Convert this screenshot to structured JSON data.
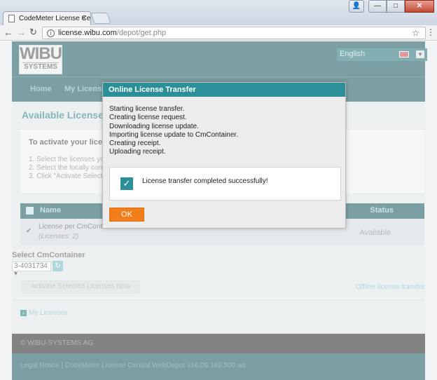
{
  "browser": {
    "tab_title": "CodeMeter License Centr",
    "url_host": "license.wibu.com",
    "url_path": "/depot/get.php"
  },
  "header": {
    "logo_top": "WIBU",
    "logo_bottom": "SYSTEMS",
    "language": "English"
  },
  "nav": {
    "items": [
      "Home",
      "My License"
    ]
  },
  "main": {
    "title": "Available Licenses",
    "activate_title": "To activate your licens",
    "steps": [
      "1. Select the licenses yo",
      "2. Select the locally con",
      "3. Click \"Activate Select"
    ],
    "table": {
      "col_name": "Name",
      "col_status": "Status",
      "row_name": "License per CmConta",
      "row_count": "(Licenses: 2)",
      "row_status": "Available"
    },
    "select_label": "Select CmContainer",
    "select_value": "3-4031734",
    "activate_button": "Activate Selected Licenses Now",
    "offline_link": "Offline license transfer",
    "my_licenses": "My Licenses"
  },
  "footer": {
    "copyright": "© WIBU-SYSTEMS AG",
    "legal": "Legal Notice | CodeMeter License Central WebDepot v16.06.169.500.ws"
  },
  "modal": {
    "title": "Online License Transfer",
    "log": [
      "Starting license transfer.",
      "Creating license request.",
      "Downloading license update.",
      "Importing license update to CmContainer.",
      "Creating receipt.",
      "Uploading receipt."
    ],
    "success_message": "License transfer completed successfully!",
    "ok_label": "OK"
  }
}
